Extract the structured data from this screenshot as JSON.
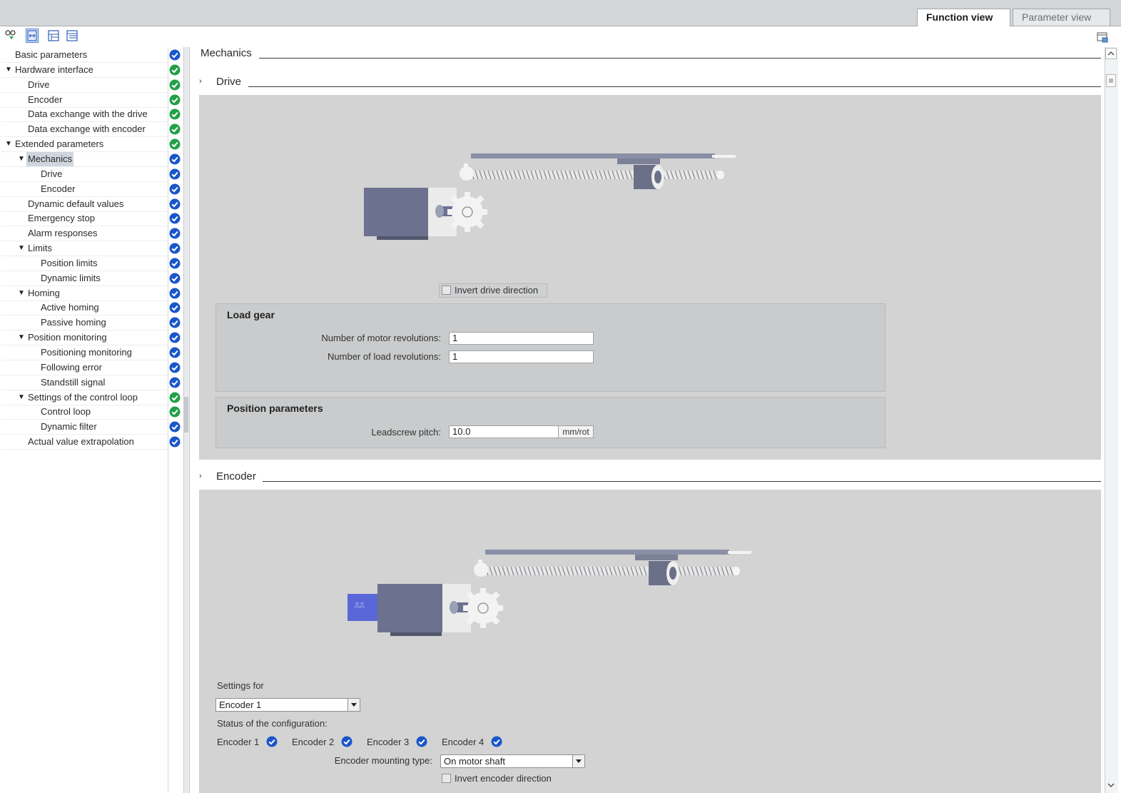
{
  "tabs": {
    "function_view": "Function view",
    "parameter_view": "Parameter view"
  },
  "toolbar_icons": [
    "glasses-icon",
    "toggle-view-icon",
    "expand-tree-icon",
    "collapse-tree-icon"
  ],
  "tree": [
    {
      "label": "Basic parameters",
      "level": 0,
      "caret": false,
      "status": "blue"
    },
    {
      "label": "Hardware interface",
      "level": 0,
      "caret": true,
      "status": "green"
    },
    {
      "label": "Drive",
      "level": 1,
      "caret": false,
      "status": "green"
    },
    {
      "label": "Encoder",
      "level": 1,
      "caret": false,
      "status": "green"
    },
    {
      "label": "Data exchange with the drive",
      "level": 1,
      "caret": false,
      "status": "green"
    },
    {
      "label": "Data exchange with encoder",
      "level": 1,
      "caret": false,
      "status": "green"
    },
    {
      "label": "Extended parameters",
      "level": 0,
      "caret": true,
      "status": "green"
    },
    {
      "label": "Mechanics",
      "level": 1,
      "caret": true,
      "status": "blue",
      "selected": true
    },
    {
      "label": "Drive",
      "level": 2,
      "caret": false,
      "status": "blue"
    },
    {
      "label": "Encoder",
      "level": 2,
      "caret": false,
      "status": "blue"
    },
    {
      "label": "Dynamic default values",
      "level": 1,
      "caret": false,
      "status": "blue"
    },
    {
      "label": "Emergency stop",
      "level": 1,
      "caret": false,
      "status": "blue"
    },
    {
      "label": "Alarm responses",
      "level": 1,
      "caret": false,
      "status": "blue"
    },
    {
      "label": "Limits",
      "level": 1,
      "caret": true,
      "status": "blue"
    },
    {
      "label": "Position limits",
      "level": 2,
      "caret": false,
      "status": "blue"
    },
    {
      "label": "Dynamic limits",
      "level": 2,
      "caret": false,
      "status": "blue"
    },
    {
      "label": "Homing",
      "level": 1,
      "caret": true,
      "status": "blue"
    },
    {
      "label": "Active homing",
      "level": 2,
      "caret": false,
      "status": "blue"
    },
    {
      "label": "Passive homing",
      "level": 2,
      "caret": false,
      "status": "blue"
    },
    {
      "label": "Position monitoring",
      "level": 1,
      "caret": true,
      "status": "blue"
    },
    {
      "label": "Positioning monitoring",
      "level": 2,
      "caret": false,
      "status": "blue"
    },
    {
      "label": "Following error",
      "level": 2,
      "caret": false,
      "status": "blue"
    },
    {
      "label": "Standstill signal",
      "level": 2,
      "caret": false,
      "status": "blue"
    },
    {
      "label": "Settings of the control loop",
      "level": 1,
      "caret": true,
      "status": "green"
    },
    {
      "label": "Control loop",
      "level": 2,
      "caret": false,
      "status": "green"
    },
    {
      "label": "Dynamic filter",
      "level": 2,
      "caret": false,
      "status": "blue"
    },
    {
      "label": "Actual value extrapolation",
      "level": 1,
      "caret": false,
      "status": "blue"
    }
  ],
  "status_colors": {
    "blue": "#1a56c9",
    "green": "#23a047"
  },
  "main": {
    "mechanics_title": "Mechanics",
    "drive": {
      "title": "Drive",
      "invert_label": "Invert drive direction",
      "load_gear": {
        "title": "Load gear",
        "motor_rev_label": "Number of motor revolutions:",
        "motor_rev_value": "1",
        "load_rev_label": "Number of load revolutions:",
        "load_rev_value": "1"
      },
      "position_params": {
        "title": "Position parameters",
        "leadscrew_label": "Leadscrew pitch:",
        "leadscrew_value": "10.0",
        "leadscrew_unit": "mm/rot"
      }
    },
    "encoder": {
      "title": "Encoder",
      "settings_for_label": "Settings for",
      "settings_for_value": "Encoder 1",
      "status_label": "Status of the configuration:",
      "encoders": [
        "Encoder 1",
        "Encoder 2",
        "Encoder 3",
        "Encoder 4"
      ],
      "mounting_label": "Encoder mounting type:",
      "mounting_value": "On motor shaft",
      "invert_label": "Invert encoder direction",
      "encoder_badge": "⎍⎍"
    }
  }
}
